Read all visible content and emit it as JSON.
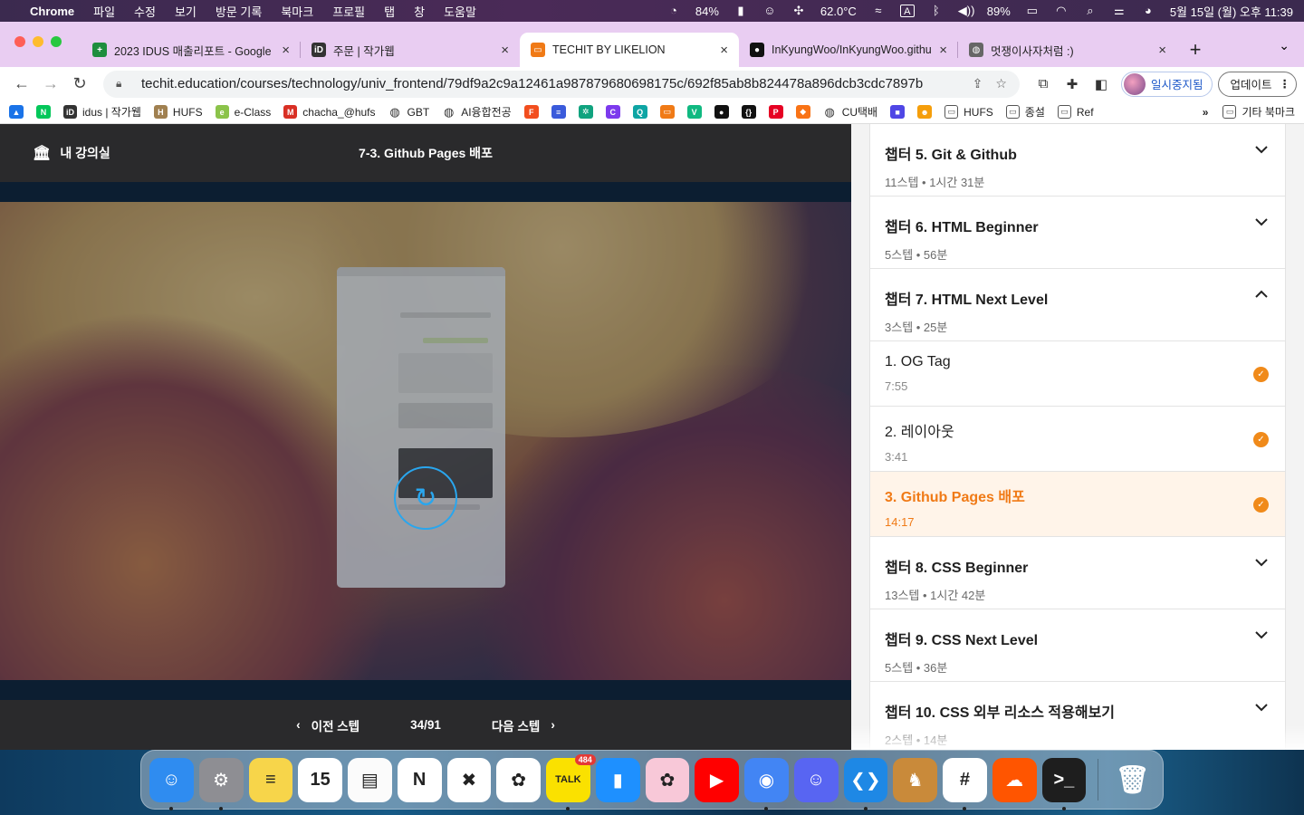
{
  "menubar": {
    "app": "Chrome",
    "menus": [
      "파일",
      "수정",
      "보기",
      "방문 기록",
      "북마크",
      "프로필",
      "탭",
      "창",
      "도움말"
    ],
    "battery_cpu": "84%",
    "temperature": "62.0°C",
    "input_source": "A",
    "battery": "89%",
    "datetime": "5월 15일 (월) 오후 11:39"
  },
  "tabs": [
    {
      "title": "2023 IDUS 매출리포트 - Google",
      "favicon": "sheets-icon",
      "color": "#1e8e3e",
      "glyph": "+"
    },
    {
      "title": "주문 | 작가웹",
      "favicon": "idus-icon",
      "color": "#333333",
      "glyph": "iD"
    },
    {
      "title": "TECHIT BY LIKELION",
      "favicon": "techit-icon",
      "color": "#f07a16",
      "glyph": "▭"
    },
    {
      "title": "InKyungWoo/InKyungWoo.githu",
      "favicon": "github-icon",
      "color": "#111111",
      "glyph": "●"
    },
    {
      "title": "멋쟁이사자처럼 :)",
      "favicon": "globe-icon",
      "color": "#666666",
      "glyph": "◍"
    }
  ],
  "toolbar": {
    "url": "techit.education/courses/technology/univ_frontend/79df9a2c9a12461a987879680698175c/692f85ab8b824478a896dcb3cdc7897b",
    "profile_label": "일시중지됨",
    "update_label": "업데이트"
  },
  "bookmarks": [
    {
      "label": "",
      "icon": "drive-icon",
      "color": "#1a73e8",
      "glyph": "▲"
    },
    {
      "label": "",
      "icon": "naver-icon",
      "color": "#03c75a",
      "glyph": "N"
    },
    {
      "label": "idus | 작가웹",
      "icon": "idus-icon",
      "color": "#333333",
      "glyph": "iD"
    },
    {
      "label": "HUFS",
      "icon": "hufs-icon",
      "color": "#a08050",
      "glyph": "H"
    },
    {
      "label": "e-Class",
      "icon": "eclass-icon",
      "color": "#8bc34a",
      "glyph": "e"
    },
    {
      "label": "chacha_@hufs",
      "icon": "gmail-icon",
      "color": "#d93025",
      "glyph": "M"
    },
    {
      "label": "GBT",
      "icon": "globe-icon",
      "color": "#333333",
      "glyph": "◍"
    },
    {
      "label": "AI융합전공",
      "icon": "globe-icon",
      "color": "#333333",
      "glyph": "◍"
    },
    {
      "label": "",
      "icon": "figma-icon",
      "color": "#f24e1e",
      "glyph": "F"
    },
    {
      "label": "",
      "icon": "app-icon",
      "color": "#3b5bdb",
      "glyph": "≡"
    },
    {
      "label": "",
      "icon": "chatgpt-icon",
      "color": "#10a37f",
      "glyph": "✲"
    },
    {
      "label": "",
      "icon": "app-icon",
      "color": "#7c3aed",
      "glyph": "C"
    },
    {
      "label": "",
      "icon": "app-icon",
      "color": "#0ea5a4",
      "glyph": "Q"
    },
    {
      "label": "",
      "icon": "techit-icon",
      "color": "#f07a16",
      "glyph": "▭"
    },
    {
      "label": "",
      "icon": "vercel-icon",
      "color": "#10b981",
      "glyph": "V"
    },
    {
      "label": "",
      "icon": "github-icon",
      "color": "#111111",
      "glyph": "●"
    },
    {
      "label": "",
      "icon": "app-icon",
      "color": "#111111",
      "glyph": "{}"
    },
    {
      "label": "",
      "icon": "pinterest-icon",
      "color": "#e60023",
      "glyph": "P"
    },
    {
      "label": "",
      "icon": "app-icon",
      "color": "#f97316",
      "glyph": "◆"
    },
    {
      "label": "CU택배",
      "icon": "globe-icon",
      "color": "#333333",
      "glyph": "◍"
    },
    {
      "label": "",
      "icon": "app-icon",
      "color": "#4f46e5",
      "glyph": "■"
    },
    {
      "label": "",
      "icon": "emoji-icon",
      "color": "#f59e0b",
      "glyph": "☻"
    },
    {
      "label": "HUFS",
      "icon": "folder-icon",
      "color": "#555555",
      "glyph": "▭"
    },
    {
      "label": "종설",
      "icon": "folder-icon",
      "color": "#555555",
      "glyph": "▭"
    },
    {
      "label": "Ref",
      "icon": "folder-icon",
      "color": "#555555",
      "glyph": "▭"
    }
  ],
  "bookmarks_more": "»",
  "bookmarks_other": "기타 북마크",
  "player": {
    "home_label": "내 강의실",
    "title": "7-3. Github Pages 배포",
    "prev_label": "이전 스텝",
    "next_label": "다음 스텝",
    "progress": "34/91"
  },
  "curriculum": {
    "chapters_before": [
      {
        "title": "챕터 5. Git & Github",
        "meta": "11스텝 • 1시간 31분",
        "expanded": false
      },
      {
        "title": "챕터 6. HTML Beginner",
        "meta": "5스텝 • 56분",
        "expanded": false
      }
    ],
    "open_chapter": {
      "title": "챕터 7. HTML Next Level",
      "meta": "3스텝 • 25분",
      "expanded": true
    },
    "steps": [
      {
        "title": "1. OG Tag",
        "duration": "7:55",
        "done": true,
        "current": false
      },
      {
        "title": "2. 레이아웃",
        "duration": "3:41",
        "done": true,
        "current": false
      },
      {
        "title": "3. Github Pages 배포",
        "duration": "14:17",
        "done": true,
        "current": true
      }
    ],
    "chapters_after": [
      {
        "title": "챕터 8. CSS Beginner",
        "meta": "13스텝 • 1시간 42분",
        "expanded": false
      },
      {
        "title": "챕터 9. CSS Next Level",
        "meta": "5스텝 • 36분",
        "expanded": false
      },
      {
        "title": "챕터 10. CSS 외부 리소스 적용해보기",
        "meta": "2스텝 • 14분",
        "expanded": false
      }
    ]
  },
  "dock": [
    {
      "name": "finder-icon",
      "color": "#2f8cf0",
      "glyph": "☺",
      "running": true
    },
    {
      "name": "system-settings-icon",
      "color": "#8e8e93",
      "glyph": "⚙",
      "running": true
    },
    {
      "name": "stickies-icon",
      "color": "#f7d54a",
      "glyph": "≡",
      "running": false
    },
    {
      "name": "calendar-icon",
      "color": "#ffffff",
      "glyph": "15",
      "running": false
    },
    {
      "name": "notes-icon",
      "color": "#fbfbfb",
      "glyph": "▤",
      "running": false
    },
    {
      "name": "notion-icon",
      "color": "#ffffff",
      "glyph": "N",
      "running": false
    },
    {
      "name": "capcut-icon",
      "color": "#ffffff",
      "glyph": "✖",
      "running": false
    },
    {
      "name": "photos-icon",
      "color": "#ffffff",
      "glyph": "✿",
      "running": false
    },
    {
      "name": "kakaotalk-icon",
      "color": "#fae100",
      "glyph": "TALK",
      "running": true,
      "badge": "484"
    },
    {
      "name": "bookmark-app-icon",
      "color": "#1e90ff",
      "glyph": "▮",
      "running": false
    },
    {
      "name": "sakura-icon",
      "color": "#f8c8d8",
      "glyph": "✿",
      "running": false
    },
    {
      "name": "youtube-icon",
      "color": "#ff0000",
      "glyph": "▶",
      "running": false
    },
    {
      "name": "chrome-icon",
      "color": "#4285f4",
      "glyph": "◉",
      "running": true
    },
    {
      "name": "discord-icon",
      "color": "#5865f2",
      "glyph": "☺",
      "running": false
    },
    {
      "name": "vscode-icon",
      "color": "#1e88e5",
      "glyph": "❮❯",
      "running": true
    },
    {
      "name": "chicken-game-icon",
      "color": "#c98a3a",
      "glyph": "♞",
      "running": false
    },
    {
      "name": "slack-icon",
      "color": "#ffffff",
      "glyph": "#",
      "running": true
    },
    {
      "name": "soundcloud-icon",
      "color": "#ff5500",
      "glyph": "☁",
      "running": false
    },
    {
      "name": "terminal-icon",
      "color": "#1e1e1e",
      "glyph": ">_",
      "running": true
    }
  ],
  "dock_trash": {
    "name": "trash-icon",
    "color": "#d8d8d8",
    "glyph": "🗑"
  },
  "colors": {
    "accent": "#f07a16",
    "tabbar": "#e9cdf2",
    "player_bg": "#2a2a2c",
    "spinner": "#29a6ee"
  }
}
